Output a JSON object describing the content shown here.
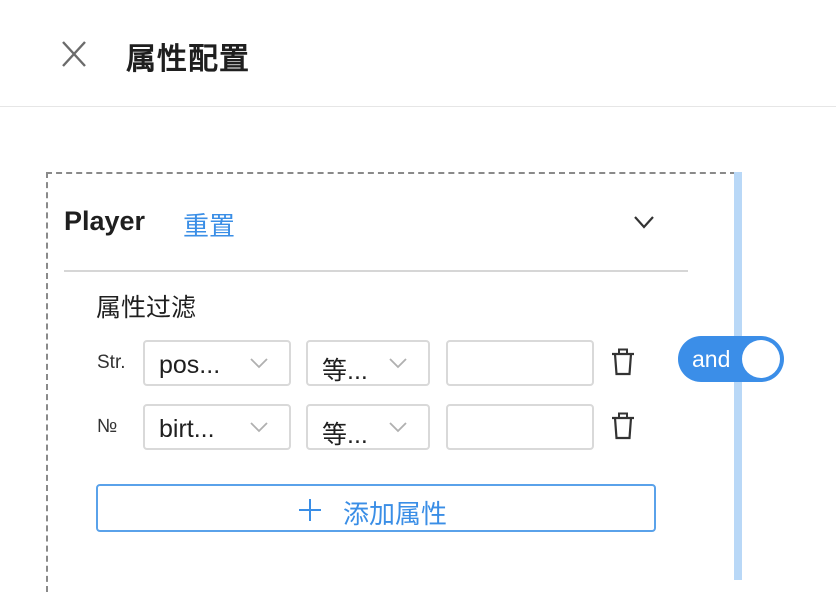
{
  "header": {
    "title": "属性配置",
    "close_icon": "close-icon"
  },
  "entity": {
    "name": "Player",
    "reset_label": "重置",
    "collapse_icon": "chevron-down-icon"
  },
  "filter": {
    "section_title": "属性过滤",
    "logic_toggle": {
      "label": "and",
      "state": "on",
      "color": "#3b8ee8"
    },
    "rows": [
      {
        "type_icon": "Str.",
        "property": "pos...",
        "operator": "等...",
        "value": "",
        "delete_icon": "trash-icon"
      },
      {
        "type_icon": "№",
        "property": "birt...",
        "operator": "等...",
        "value": "",
        "delete_icon": "trash-icon"
      }
    ],
    "add_button_label": "添加属性"
  },
  "colors": {
    "accent": "#3a8ee6",
    "side_bar": "#b9d8f7"
  }
}
